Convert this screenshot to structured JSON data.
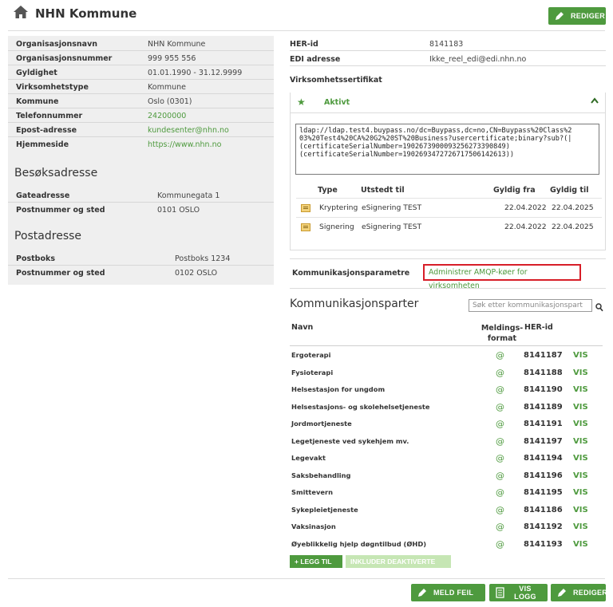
{
  "header": {
    "title": "NHN Kommune",
    "edit_label": "REDIGER"
  },
  "org": [
    {
      "label": "Organisasjonsnavn",
      "value": "NHN Kommune",
      "link": false
    },
    {
      "label": "Organisasjonsnummer",
      "value": "999 955 556",
      "link": false
    },
    {
      "label": "Gyldighet",
      "value": "01.01.1990 - 31.12.9999",
      "link": false
    },
    {
      "label": "Virksomhetstype",
      "value": "Kommune",
      "link": false
    },
    {
      "label": "Kommune",
      "value": "Oslo (0301)",
      "link": false
    },
    {
      "label": "Telefonnummer",
      "value": "24200000",
      "link": true
    },
    {
      "label": "Epost-adresse",
      "value": "kundesenter@nhn.no",
      "link": true
    },
    {
      "label": "Hjemmeside",
      "value": "https://www.nhn.no",
      "link": true
    }
  ],
  "visit": {
    "heading": "Besøksadresse",
    "rows": [
      {
        "label": "Gateadresse",
        "value": "Kommunegata 1"
      },
      {
        "label": "Postnummer og sted",
        "value": "0101 OSLO"
      }
    ]
  },
  "post": {
    "heading": "Postadresse",
    "rows": [
      {
        "label": "Postboks",
        "value": "Postboks 1234"
      },
      {
        "label": "Postnummer og sted",
        "value": "0102 OSLO"
      }
    ]
  },
  "right": {
    "her_label": "HER-id",
    "her_value": "8141183",
    "edi_label": "EDI adresse",
    "edi_value": "Ikke_reel_edi@edi.nhn.no",
    "cert_heading": "Virksomhetssertifikat",
    "cert_status": "Aktivt",
    "ldap": "ldap://ldap.test4.buypass.no/dc=Buypass,dc=no,CN=Buypass%20Class%2\n03%20Test4%20CA%20G2%20ST%20Business?usercertificate;binary?sub?(|\n(certificateSerialNumber=1902673900093256273390849)\n(certificateSerialNumber=1902693472726717506142613))",
    "cert_cols": {
      "type": "Type",
      "issued": "Utstedt til",
      "from": "Gyldig fra",
      "to": "Gyldig til"
    },
    "certs": [
      {
        "type": "Kryptering",
        "issued": "eSignering TEST",
        "from": "22.04.2022",
        "to": "22.04.2025"
      },
      {
        "type": "Signering",
        "issued": "eSignering TEST",
        "from": "22.04.2022",
        "to": "22.04.2025"
      }
    ],
    "komm_label": "Kommunikasjonsparametre",
    "komm_link": "Administrer AMQP-køer for virksomheten"
  },
  "parties": {
    "heading": "Kommunikasjonsparter",
    "search_placeholder": "Søk etter kommunikasjonspart",
    "col_name": "Navn",
    "col_format_1": "Meldings-",
    "col_format_2": "format",
    "col_her": "HER-id",
    "vis": "VIS",
    "at": "@",
    "rows": [
      {
        "name": "Ergoterapi",
        "her": "8141187"
      },
      {
        "name": "Fysioterapi",
        "her": "8141188"
      },
      {
        "name": "Helsestasjon for ungdom",
        "her": "8141190"
      },
      {
        "name": "Helsestasjons- og skolehelsetjeneste",
        "her": "8141189"
      },
      {
        "name": "Jordmortjeneste",
        "her": "8141191"
      },
      {
        "name": "Legetjeneste ved sykehjem mv.",
        "her": "8141197"
      },
      {
        "name": "Legevakt",
        "her": "8141194"
      },
      {
        "name": "Saksbehandling",
        "her": "8141196"
      },
      {
        "name": "Smittevern",
        "her": "8141195"
      },
      {
        "name": "Sykepleietjeneste",
        "her": "8141186"
      },
      {
        "name": "Vaksinasjon",
        "her": "8141192"
      },
      {
        "name": "Øyeblikkelig hjelp døgntilbud (ØHD)",
        "her": "8141193"
      }
    ],
    "add_label": "+ LEGG TIL",
    "include_label": "INKLUDER DEAKTIVERTE"
  },
  "footer": {
    "report_label": "MELD FEIL",
    "log_label": "VIS LOGG",
    "edit_label": "REDIGER"
  },
  "colors": {
    "accent": "#4e9a3e",
    "highlight": "#d71e28",
    "panel": "#efefef"
  }
}
